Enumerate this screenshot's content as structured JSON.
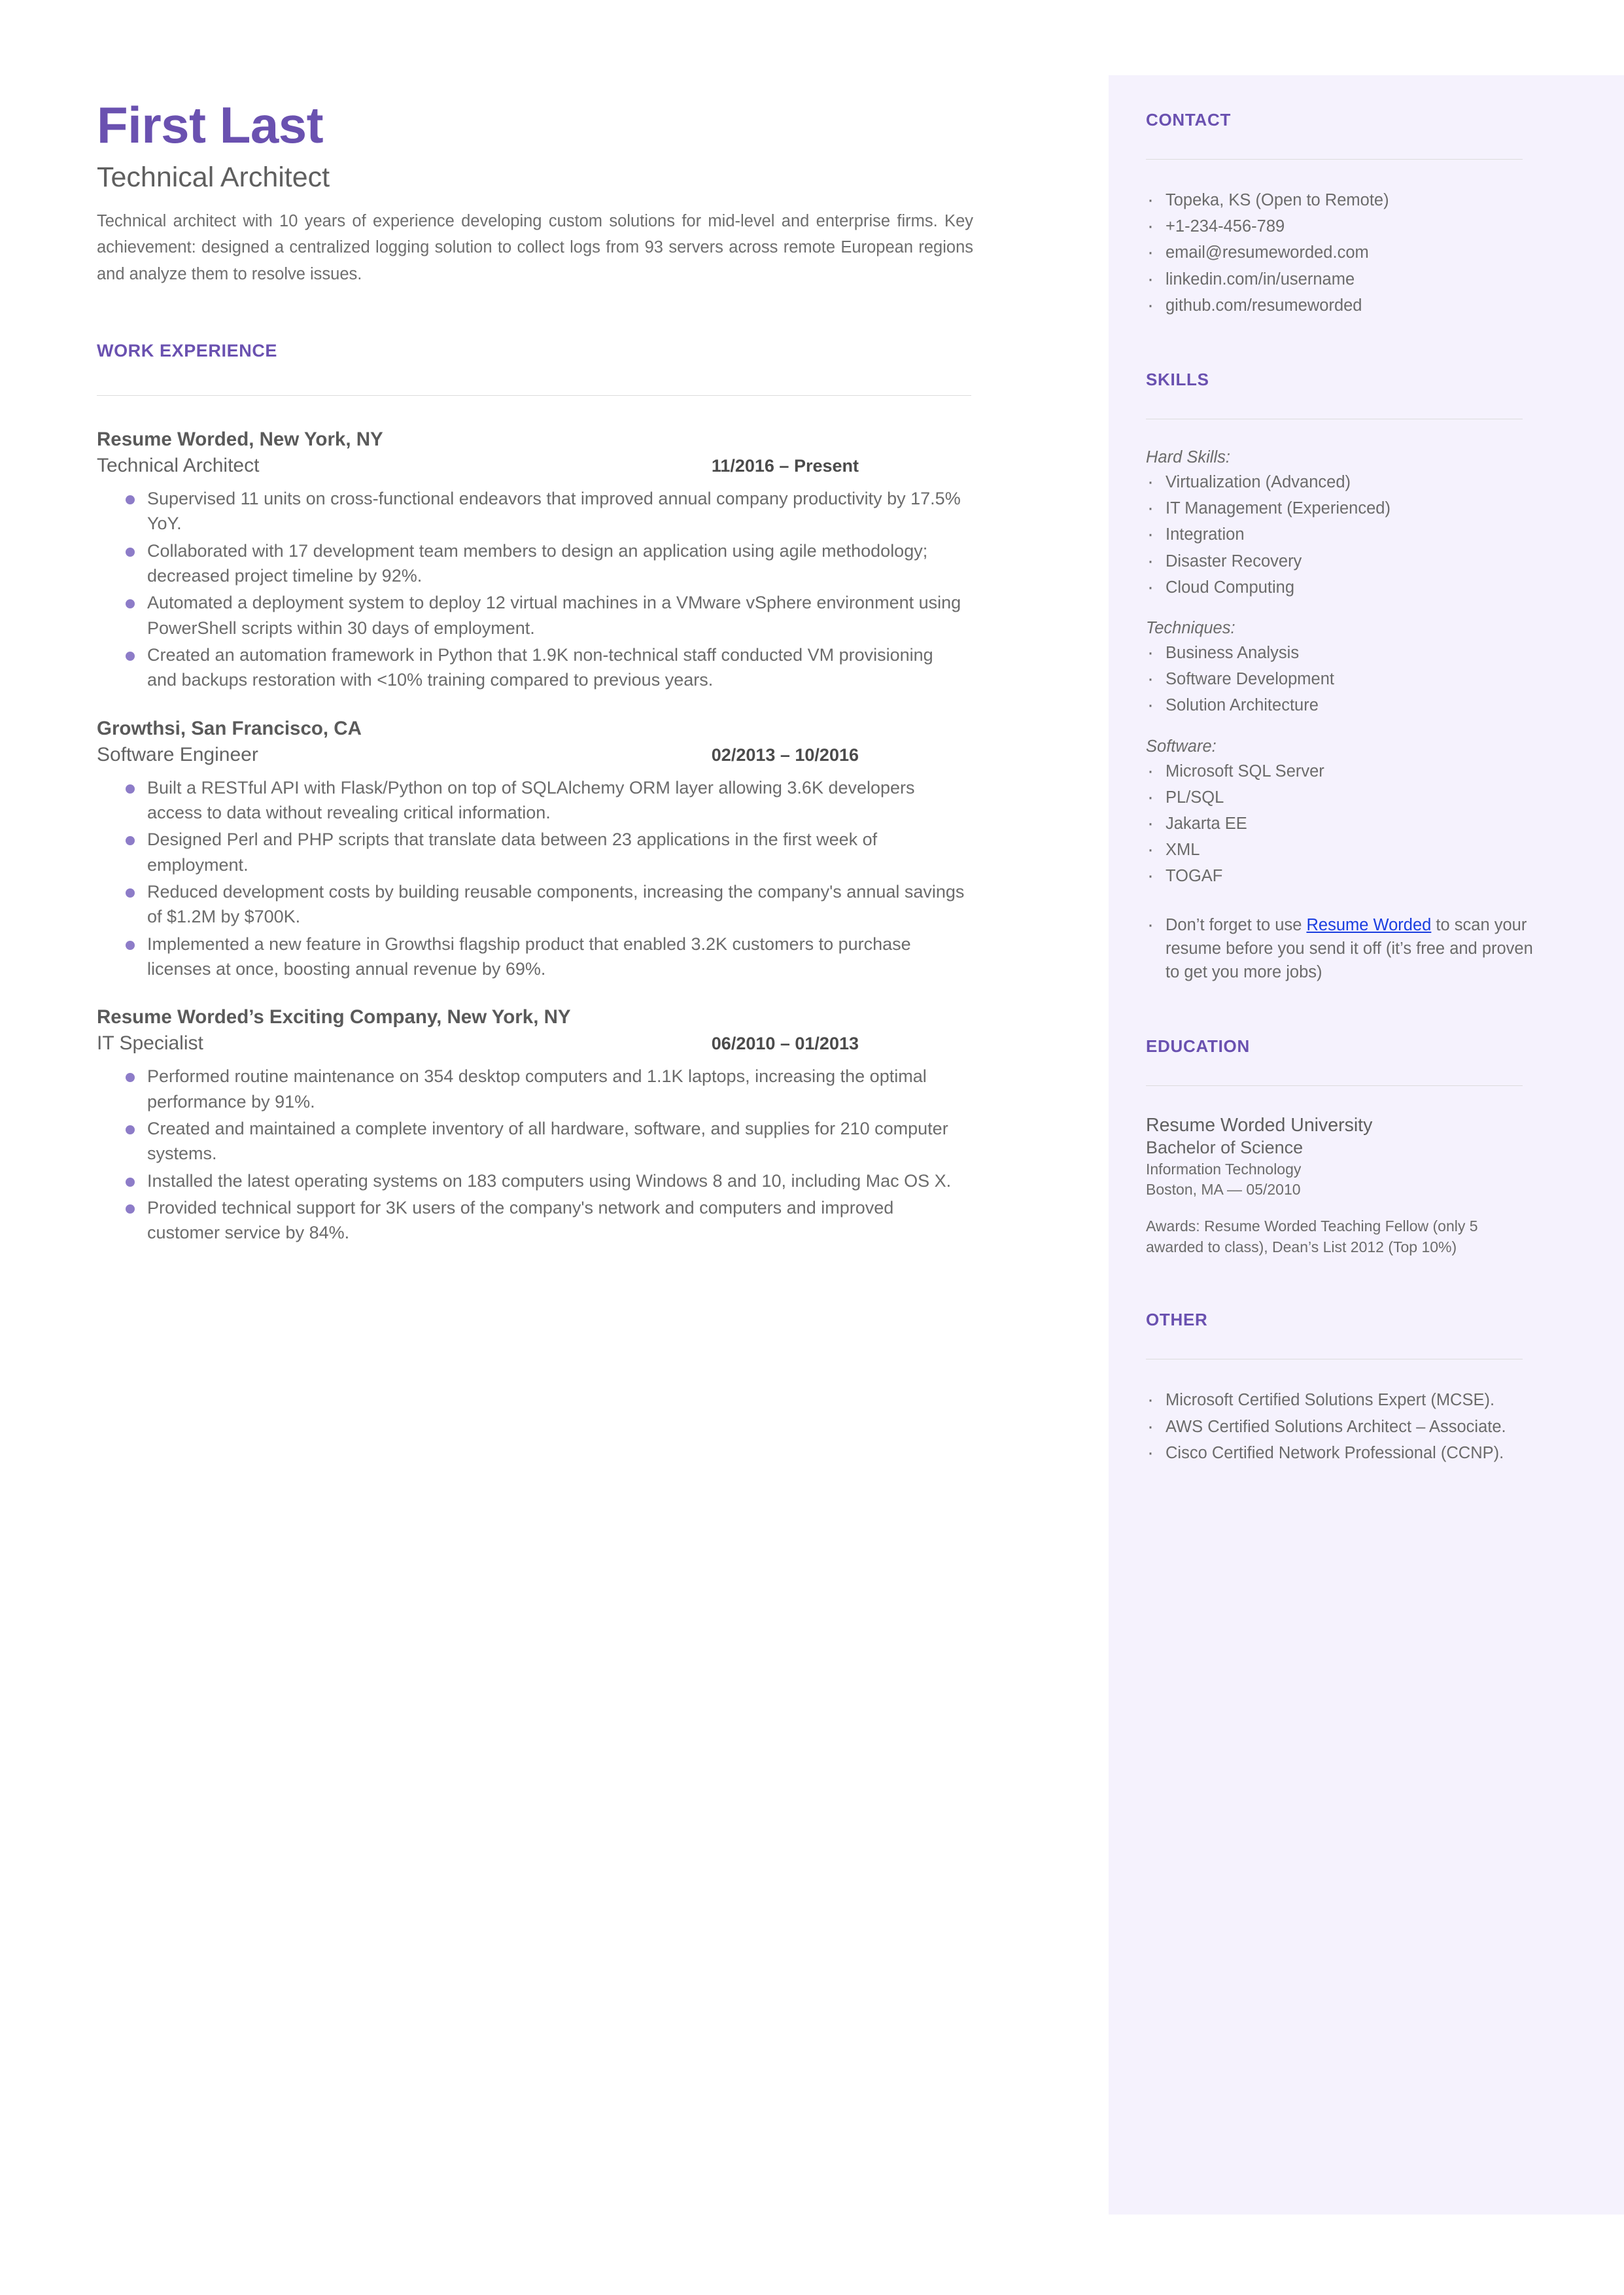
{
  "header": {
    "name": "First Last",
    "headline": "Technical Architect",
    "summary": "Technical architect with 10 years of experience developing custom solutions for mid-level and enterprise firms. Key achievement: designed a centralized logging solution to collect logs from 93 servers across remote European regions and analyze them to resolve issues."
  },
  "work": {
    "section_title": "WORK EXPERIENCE",
    "jobs": [
      {
        "company": "Resume Worded, New York, NY",
        "title": "Technical Architect",
        "dates": "11/2016 – Present",
        "bullets": [
          "Supervised 11 units on cross-functional endeavors that improved annual company productivity by 17.5% YoY.",
          "Collaborated with 17 development team members to design an application using agile methodology; decreased project timeline by 92%.",
          "Automated a deployment system to deploy 12 virtual machines in a VMware vSphere environment using PowerShell scripts within 30 days of employment.",
          "Created an automation framework in Python that 1.9K non-technical staff conducted VM provisioning and backups restoration with <10% training compared to previous years."
        ]
      },
      {
        "company": "Growthsi, San Francisco, CA",
        "title": "Software Engineer",
        "dates": "02/2013 – 10/2016",
        "bullets": [
          "Built a RESTful API with Flask/Python on top of SQLAlchemy ORM layer allowing 3.6K developers access to data without revealing critical information.",
          "Designed Perl and PHP scripts that translate data between 23 applications in the first week of employment.",
          "Reduced development costs by building reusable components, increasing the company's annual savings of $1.2M by $700K.",
          "Implemented a new feature in Growthsi flagship product that enabled 3.2K customers to purchase licenses at once, boosting annual revenue by 69%."
        ]
      },
      {
        "company": "Resume Worded’s Exciting Company, New York, NY",
        "title": "IT Specialist",
        "dates": "06/2010 – 01/2013",
        "bullets": [
          "Performed routine maintenance on 354 desktop computers and 1.1K laptops, increasing the optimal performance by 91%.",
          "Created and maintained a complete inventory of all hardware, software, and supplies for 210 computer systems.",
          "Installed the latest operating systems on 183 computers using Windows 8 and 10, including Mac OS X.",
          "Provided technical support for 3K users of the company's network and computers and improved customer service by 84%."
        ]
      }
    ]
  },
  "contact": {
    "section_title": "CONTACT",
    "items": [
      "Topeka, KS (Open to Remote)",
      "+1-234-456-789",
      "email@resumeworded.com",
      "linkedin.com/in/username",
      "github.com/resumeworded"
    ]
  },
  "skills": {
    "section_title": "SKILLS",
    "groups": [
      {
        "label": "Hard Skills:",
        "items": [
          "Virtualization (Advanced)",
          "IT Management (Experienced)",
          "Integration",
          "Disaster Recovery",
          "Cloud Computing"
        ]
      },
      {
        "label": "Techniques:",
        "items": [
          "Business Analysis",
          "Software Development",
          "Solution Architecture"
        ]
      },
      {
        "label": "Software:",
        "items": [
          "Microsoft SQL Server",
          "PL/SQL",
          "Jakarta EE",
          "XML",
          "TOGAF"
        ]
      }
    ],
    "promo": {
      "before": "Don’t forget to use ",
      "link": "Resume Worded",
      "after": " to scan your resume before you send it off (it’s free and proven to get you more jobs)"
    }
  },
  "education": {
    "section_title": "EDUCATION",
    "school": "Resume Worded University",
    "degree": "Bachelor of Science",
    "field": "Information Technology",
    "place": "Boston, MA — 05/2010",
    "awards": "Awards: Resume Worded Teaching Fellow (only 5 awarded to class), Dean’s List 2012 (Top 10%)"
  },
  "other": {
    "section_title": "OTHER",
    "items": [
      "Microsoft Certified Solutions Expert (MCSE).",
      "AWS Certified Solutions Architect – Associate.",
      "Cisco Certified Network Professional (CCNP)."
    ]
  },
  "colors": {
    "accent_purple": "#6a51b0",
    "bullet_purple": "#8d7cc8",
    "sidebar_bg": "#f5f2fd",
    "link_blue": "#1a3ee0",
    "body_text": "#6b6b6b",
    "rule": "#dcdcdc"
  }
}
